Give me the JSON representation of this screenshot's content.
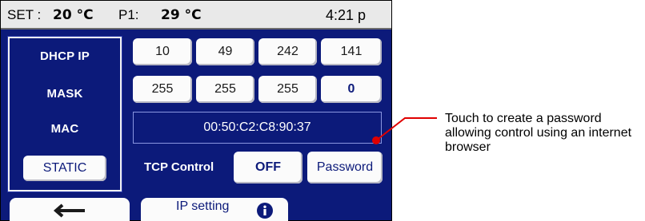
{
  "status": {
    "set_label": "SET :",
    "set_value": "20 °C",
    "p1_label": "P1:",
    "p1_value": "29 °C",
    "time": "4:21 p"
  },
  "labels": {
    "dhcp_ip": "DHCP IP",
    "mask": "MASK",
    "mac": "MAC",
    "static_button": "STATIC"
  },
  "ip_octets": [
    "10",
    "49",
    "242",
    "141"
  ],
  "mask_octets": [
    "255",
    "255",
    "255",
    "0"
  ],
  "mac_address": "00:50:C2:C8:90:37",
  "tcp_control": {
    "label": "TCP Control",
    "state": "OFF",
    "password_button": "Password"
  },
  "bottom": {
    "back_icon": "back-arrow-icon",
    "tab_label": "IP setting",
    "info_icon": "info-icon"
  },
  "callout": "Touch to create a password allowing control using an internet browser",
  "colors": {
    "screen_bg": "#0c1a7a",
    "button_bg": "#fbfbfb",
    "callout_line": "#e00000"
  }
}
